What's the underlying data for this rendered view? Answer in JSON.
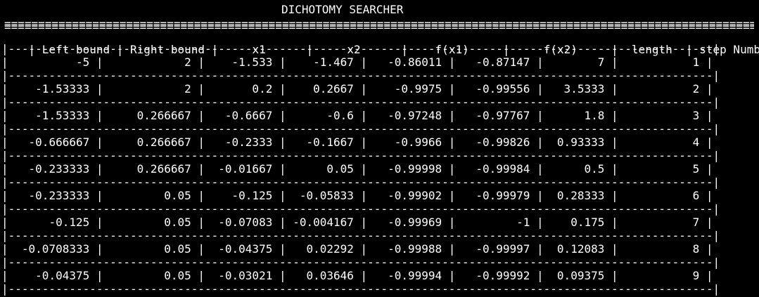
{
  "title": "DICHOTOMY SEARCHER",
  "header": [
    "Left bound",
    "Right bound",
    "x1",
    "x2",
    "f(x1)",
    "f(x2)",
    "length",
    "step Number"
  ],
  "rows": [
    [
      "-5",
      "2",
      "-1.533",
      "-1.467",
      "-0.86011",
      "-0.87147",
      "7",
      "1"
    ],
    [
      "-1.53333",
      "2",
      "0.2",
      "0.2667",
      "-0.9975",
      "-0.99556",
      "3.5333",
      "2"
    ],
    [
      "-1.53333",
      "0.266667",
      "-0.6667",
      "-0.6",
      "-0.97248",
      "-0.97767",
      "1.8",
      "3"
    ],
    [
      "-0.666667",
      "0.266667",
      "-0.2333",
      "-0.1667",
      "-0.9966",
      "-0.99826",
      "0.93333",
      "4"
    ],
    [
      "-0.233333",
      "0.266667",
      "-0.01667",
      "0.05",
      "-0.99998",
      "-0.99984",
      "0.5",
      "5"
    ],
    [
      "-0.233333",
      "0.05",
      "-0.125",
      "-0.05833",
      "-0.99902",
      "-0.99979",
      "0.28333",
      "6"
    ],
    [
      "-0.125",
      "0.05",
      "-0.07083",
      "-0.004167",
      "-0.99969",
      "-1",
      "0.175",
      "7"
    ],
    [
      "-0.0708333",
      "0.05",
      "-0.04375",
      "0.02292",
      "-0.99988",
      "-0.99997",
      "0.12083",
      "8"
    ],
    [
      "-0.04375",
      "0.05",
      "-0.03021",
      "0.03646",
      "-0.99994",
      "-0.99992",
      "0.09375",
      "9"
    ]
  ]
}
